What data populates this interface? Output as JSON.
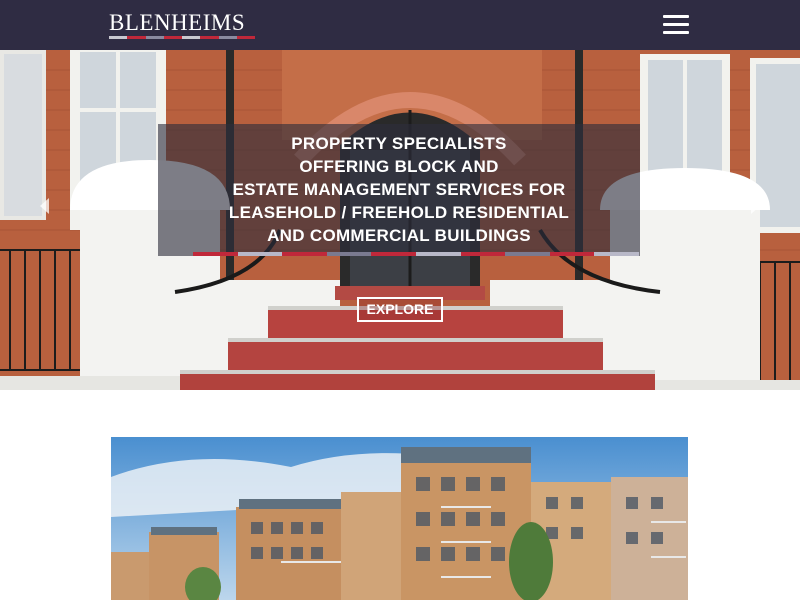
{
  "header": {
    "logo_text": "BLENHEIMS",
    "logo_stripe_colors": [
      "#c8c8d0",
      "#c0283a",
      "#8a8aa0",
      "#c0283a",
      "#c8c8d0",
      "#c0283a",
      "#8a8aa0",
      "#c0283a"
    ],
    "menu_icon": "hamburger-menu-icon",
    "background_color": "#2f2c43"
  },
  "hero": {
    "caption_lines": [
      "PROPERTY SPECIALISTS",
      "OFFERING BLOCK AND",
      "ESTATE MANAGEMENT SERVICES FOR",
      "LEASEHOLD / FREEHOLD RESIDENTIAL",
      "AND COMMERCIAL BUILDINGS"
    ],
    "explore_label": "EXPLORE",
    "prev_icon": "chevron-left-icon",
    "next_icon": "chevron-right-icon",
    "stripe_colors": [
      "#c0283a",
      "#b8b8c8",
      "#c0283a",
      "#7a7a90",
      "#c0283a",
      "#b8b8c8",
      "#c0283a",
      "#7a7a90",
      "#c0283a",
      "#b8b8c8"
    ],
    "image": "apartment-building-entrance-photo"
  },
  "feature": {
    "image": "modern-apartment-blocks-photo"
  }
}
